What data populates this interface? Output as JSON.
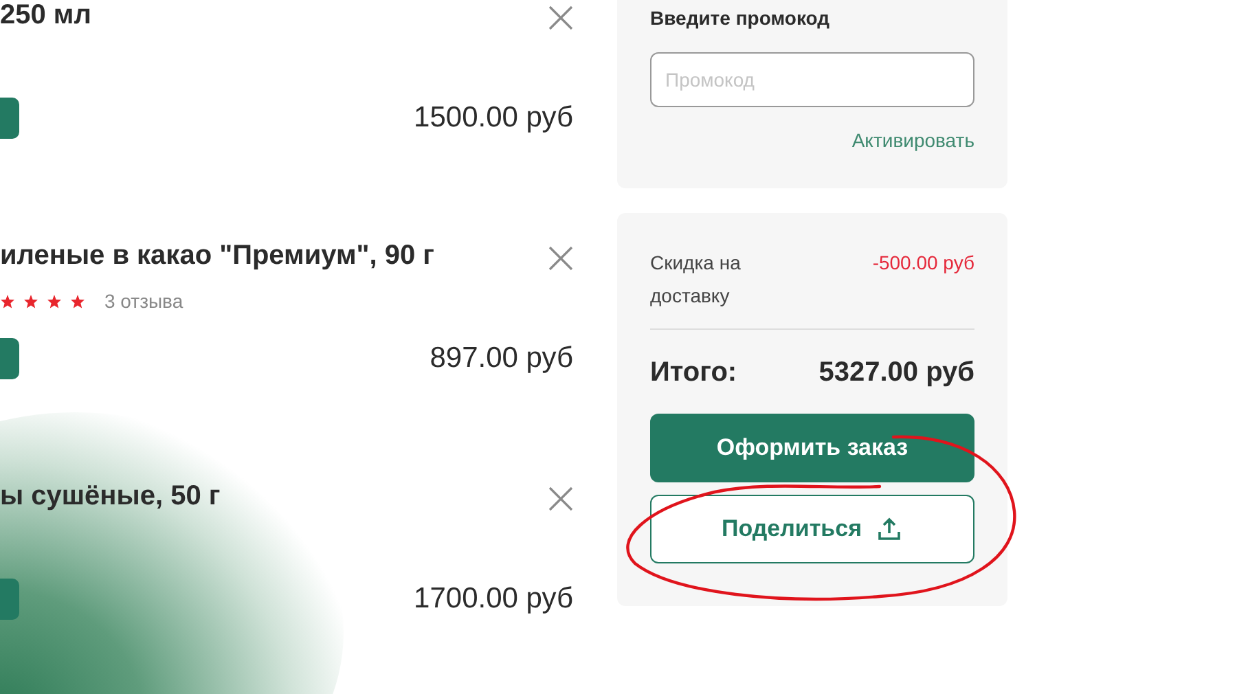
{
  "cart_items": [
    {
      "name": "250 мл",
      "price": "1500.00 руб"
    },
    {
      "name": "иленые в какао \"Премиум\", 90 г",
      "stars": 4,
      "reviews": "3 отзыва",
      "price": "897.00 руб"
    },
    {
      "name": "ы сушёные, 50 г",
      "price": "1700.00 руб"
    }
  ],
  "promo": {
    "label": "Введите промокод",
    "placeholder": "Промокод",
    "activate": "Активировать"
  },
  "summary": {
    "discount_label": "Скидка на доставку",
    "discount_value": "-500.00 руб",
    "total_label": "Итого:",
    "total_value": "5327.00 руб",
    "order_button": "Оформить заказ",
    "share_button": "Поделиться"
  }
}
